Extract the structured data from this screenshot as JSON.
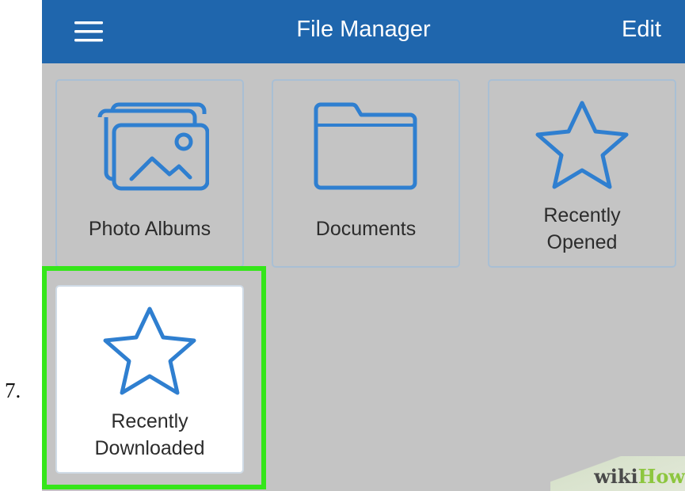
{
  "step": {
    "number": "7."
  },
  "nav": {
    "title": "File Manager",
    "edit_label": "Edit",
    "bar_color": "#1f66ad",
    "menu_icon": "hamburger-menu-icon"
  },
  "tiles": [
    {
      "label": "Photo Albums",
      "icon": "photo-albums-icon"
    },
    {
      "label": "Documents",
      "icon": "folder-icon"
    },
    {
      "label": "Recently\nOpened",
      "icon": "star-icon"
    },
    {
      "label": "Recently\nDownloaded",
      "icon": "star-icon",
      "highlighted": true
    }
  ],
  "colors": {
    "icon_stroke": "#2f7fd0",
    "highlight": "#35e61a",
    "background": "#c4c4c4"
  },
  "watermark": {
    "wiki": "wiki",
    "how": "How"
  }
}
